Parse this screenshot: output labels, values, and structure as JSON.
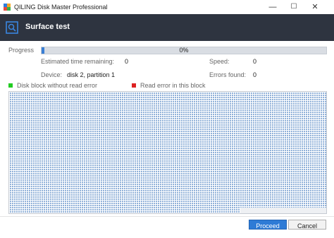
{
  "window": {
    "title": "QILING Disk Master Professional",
    "icon": "app-logo",
    "controls": {
      "minimize": "—",
      "maximize": "☐",
      "close": "✕"
    }
  },
  "header": {
    "title": "Surface test",
    "icon": "surface-test-icon"
  },
  "progress": {
    "label": "Progress",
    "percent_text": "0%",
    "value": 0.01
  },
  "stats": {
    "estimated_label": "Estimated time remaining:",
    "estimated_value": "0",
    "speed_label": "Speed:",
    "speed_value": "0",
    "device_label": "Device:",
    "device_value": "disk 2, partition 1",
    "errors_label": "Errors found:",
    "errors_value": "0"
  },
  "legend": {
    "ok_label": "Disk block without read error",
    "ok_color": "#22cc22",
    "error_label": "Read error in this block",
    "error_color": "#dd2222"
  },
  "blocks": {
    "cell_color": "#8fb0d8",
    "background": "#eef0f3"
  },
  "buttons": {
    "proceed": "Proceed",
    "cancel": "Cancel"
  },
  "colors": {
    "header_bg": "#2e3440",
    "accent": "#2e7bd6"
  }
}
